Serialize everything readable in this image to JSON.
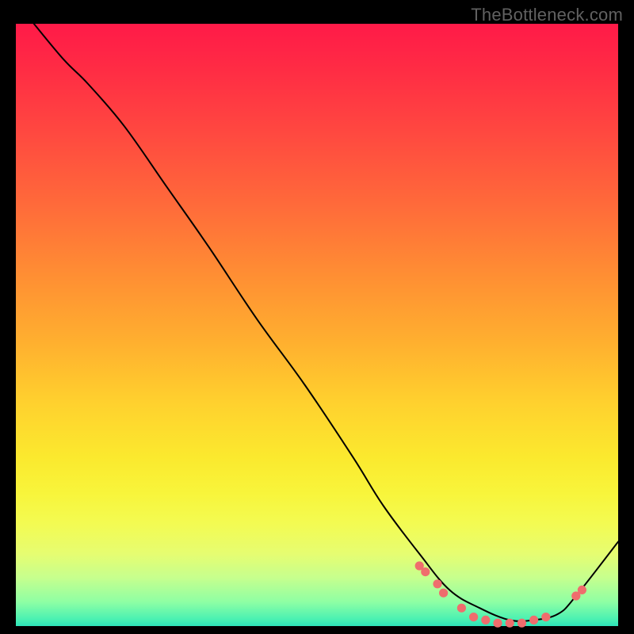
{
  "watermark": "TheBottleneck.com",
  "chart_data": {
    "type": "line",
    "title": "",
    "xlabel": "",
    "ylabel": "",
    "xlim": [
      0,
      100
    ],
    "ylim": [
      0,
      100
    ],
    "grid": false,
    "legend": false,
    "series": [
      {
        "name": "curve",
        "color": "#000000",
        "x": [
          3,
          8,
          12,
          18,
          25,
          32,
          40,
          48,
          56,
          61,
          67,
          72,
          77,
          82,
          86,
          90,
          93,
          100
        ],
        "y": [
          100,
          94,
          90,
          83,
          73,
          63,
          51,
          40,
          28,
          20,
          12,
          6,
          3,
          1,
          1,
          2,
          5,
          14
        ]
      }
    ],
    "markers": [
      {
        "x": 67,
        "y": 10,
        "r": 5.6,
        "color": "#ef6d6d"
      },
      {
        "x": 68,
        "y": 9,
        "r": 5.6,
        "color": "#ef6d6d"
      },
      {
        "x": 70,
        "y": 7,
        "r": 5.6,
        "color": "#ef6d6d"
      },
      {
        "x": 71,
        "y": 5.5,
        "r": 5.6,
        "color": "#ef6d6d"
      },
      {
        "x": 74,
        "y": 3,
        "r": 5.6,
        "color": "#ef6d6d"
      },
      {
        "x": 76,
        "y": 1.5,
        "r": 5.6,
        "color": "#ef6d6d"
      },
      {
        "x": 78,
        "y": 1,
        "r": 5.6,
        "color": "#ef6d6d"
      },
      {
        "x": 80,
        "y": 0.5,
        "r": 5.6,
        "color": "#ef6d6d"
      },
      {
        "x": 82,
        "y": 0.5,
        "r": 5.6,
        "color": "#ef6d6d"
      },
      {
        "x": 84,
        "y": 0.5,
        "r": 5.6,
        "color": "#ef6d6d"
      },
      {
        "x": 86,
        "y": 1,
        "r": 5.6,
        "color": "#ef6d6d"
      },
      {
        "x": 88,
        "y": 1.5,
        "r": 5.6,
        "color": "#ef6d6d"
      },
      {
        "x": 93,
        "y": 5,
        "r": 5.6,
        "color": "#ef6d6d"
      },
      {
        "x": 94,
        "y": 6,
        "r": 5.6,
        "color": "#ef6d6d"
      }
    ],
    "gradient_stops": [
      {
        "pos": 0,
        "color": "#ff1a48"
      },
      {
        "pos": 8,
        "color": "#ff2d44"
      },
      {
        "pos": 18,
        "color": "#ff4840"
      },
      {
        "pos": 30,
        "color": "#ff6a3a"
      },
      {
        "pos": 42,
        "color": "#ff8f33"
      },
      {
        "pos": 53,
        "color": "#ffb02f"
      },
      {
        "pos": 63,
        "color": "#ffd12e"
      },
      {
        "pos": 72,
        "color": "#fbe92e"
      },
      {
        "pos": 78,
        "color": "#f8f53b"
      },
      {
        "pos": 83,
        "color": "#f3fb52"
      },
      {
        "pos": 88,
        "color": "#e6fd71"
      },
      {
        "pos": 92,
        "color": "#c6ff8e"
      },
      {
        "pos": 96,
        "color": "#8effa4"
      },
      {
        "pos": 99,
        "color": "#47f0b3"
      },
      {
        "pos": 100,
        "color": "#2de3b9"
      }
    ]
  }
}
